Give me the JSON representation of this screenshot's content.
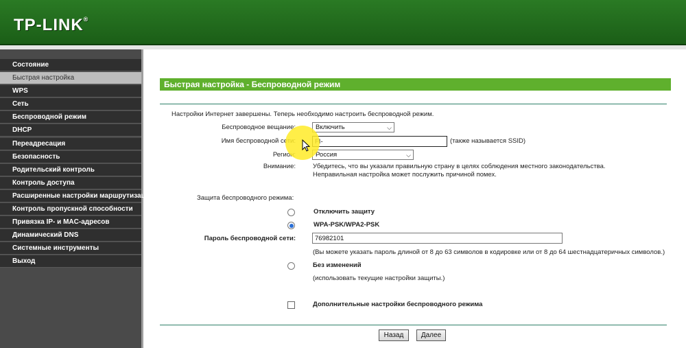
{
  "brand": {
    "logo": "TP-LINK",
    "reg": "®"
  },
  "sidebar": {
    "items": [
      {
        "label": "Состояние"
      },
      {
        "label": "Быстрая настройка",
        "active": true
      },
      {
        "label": "WPS"
      },
      {
        "label": "Сеть"
      },
      {
        "label": "Беспроводной режим"
      },
      {
        "label": "DHCP"
      },
      {
        "label": "Переадресация"
      },
      {
        "label": "Безопасность"
      },
      {
        "label": "Родительский контроль"
      },
      {
        "label": "Контроль доступа"
      },
      {
        "label": "Расширенные настройки маршрутизации"
      },
      {
        "label": "Контроль пропускной способности"
      },
      {
        "label": "Привязка IP- и MAC-адресов"
      },
      {
        "label": "Динамический DNS"
      },
      {
        "label": "Системные инструменты"
      },
      {
        "label": "Выход"
      }
    ]
  },
  "page": {
    "title": "Быстрая настройка - Беспроводной режим",
    "intro": "Настройки Интернет завершены. Теперь необходимо настроить беспроводной режим.",
    "broadcast": {
      "label": "Беспроводное вещание:",
      "value": "Включить"
    },
    "ssid": {
      "label": "Имя беспроводной сети:",
      "value": "FI-",
      "hint": "(также называется SSID)"
    },
    "region": {
      "label": "Регион:",
      "value": "Россия"
    },
    "warning": {
      "label": "Внимание:",
      "line1": "Убедитесь, что вы указали правильную страну в целях соблюдения местного законодательства.",
      "line2": "Неправильная настройка может послужить причиной помех."
    },
    "security": {
      "label": "Защита беспроводного режима:",
      "option_off": "Отключить защиту",
      "option_wpa": "WPA-PSK/WPA2-PSK",
      "password_label": "Пароль беспроводной сети:",
      "password_value": "76982101",
      "password_hint": "(Вы можете указать пароль длиной от 8 до 63 символов в кодировке или от 8 до 64 шестнадцатеричных символов.)",
      "option_nochange": "Без изменений",
      "nochange_hint": "(использовать текущие настройки защиты.)"
    },
    "advanced_label": "Дополнительные настройки беспроводного режима",
    "buttons": {
      "back": "Назад",
      "next": "Далее"
    }
  },
  "colors": {
    "header": "#1f6a1a",
    "title_bar": "#5fb02d",
    "sidebar": "#2f2f2f",
    "highlight": "#ffeb28"
  }
}
